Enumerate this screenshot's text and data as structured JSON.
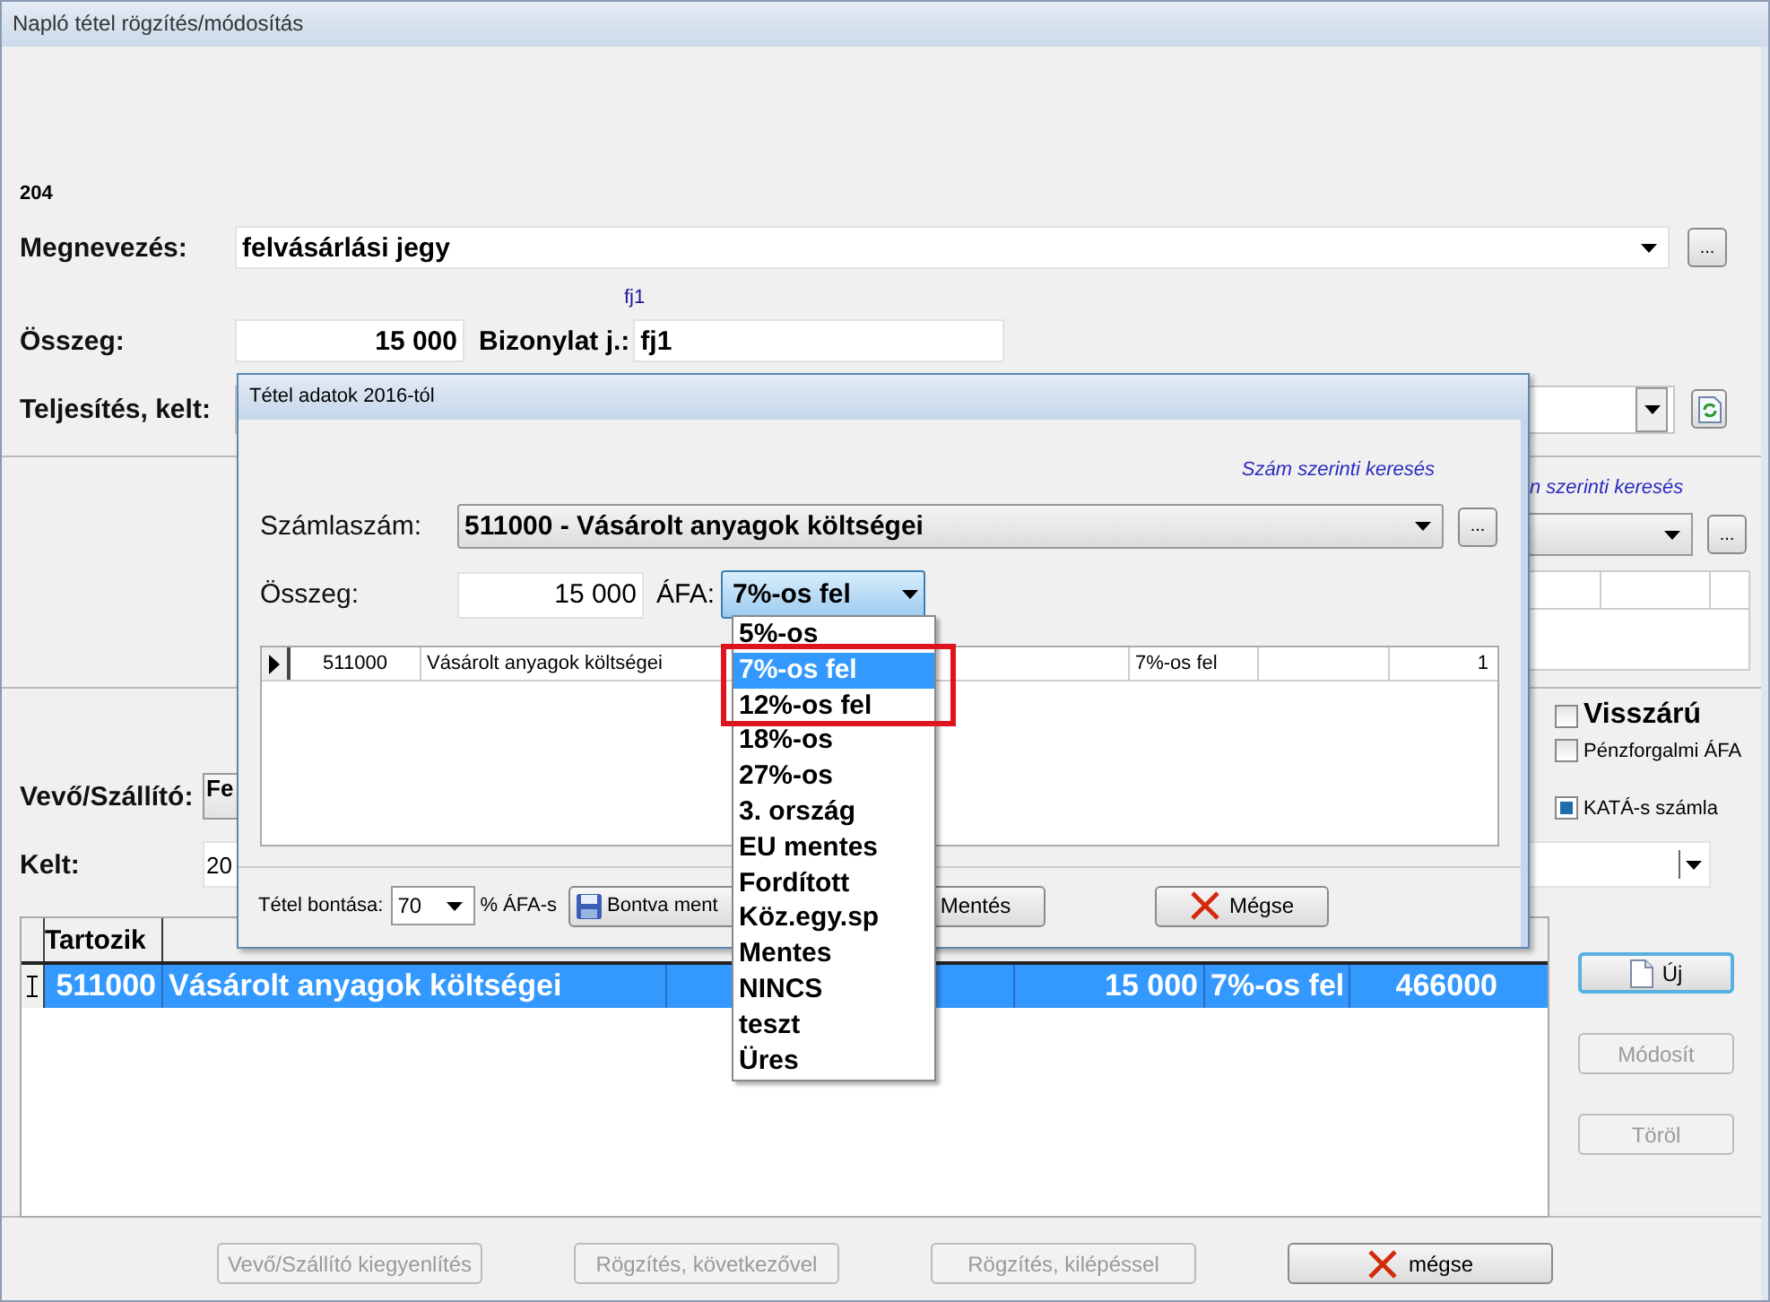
{
  "window": {
    "title": "Napló tétel rögzítés/módosítás"
  },
  "record_number": "204",
  "name_row": {
    "label": "Megnevezés:",
    "value": "felvásárlási jegy",
    "more_button": "..."
  },
  "document_hint": "fj1",
  "amount_row": {
    "label": "Összeg:",
    "value": "15 000",
    "document_label": "Bizonylat j.:",
    "document_value": "fj1"
  },
  "completion_row": {
    "label": "Teljesítés, kelt:"
  },
  "account_search": {
    "link": "n szerinti keresés",
    "more_button": "..."
  },
  "partner": {
    "label": "Vevő/Szállító:",
    "value": "Fe"
  },
  "date": {
    "label": "Kelt:",
    "value": "20"
  },
  "checkboxes": [
    {
      "label": "Visszárú",
      "checked": false,
      "kind": "large"
    },
    {
      "label": "Pénzforgalmi ÁFA",
      "checked": false,
      "kind": "small"
    },
    {
      "label": "KATÁ-s számla",
      "checked": true,
      "kind": "small"
    }
  ],
  "table": {
    "columns": [
      "Tartozik"
    ],
    "rows": [
      {
        "selected": true,
        "account": "511000",
        "name": "Vásárolt anyagok költségei",
        "amount": "15 000",
        "vat": "7%-os fel",
        "column_7": "466000"
      }
    ]
  },
  "side_buttons": [
    {
      "label": "Új",
      "disabled": false,
      "kind": "new"
    },
    {
      "label": "Módosít",
      "disabled": true,
      "kind": "plain"
    },
    {
      "label": "Töröl",
      "disabled": true,
      "kind": "plain"
    }
  ],
  "bottom_buttons": [
    {
      "label": "Vevő/Szállító kiegyenlítés",
      "disabled": true,
      "kind": "plain"
    },
    {
      "label": "Rögzítés, következővel",
      "disabled": true,
      "kind": "plain"
    },
    {
      "label": "Rögzítés, kilépéssel",
      "disabled": true,
      "kind": "plain"
    },
    {
      "label": "mégse",
      "disabled": false,
      "kind": "cancel"
    }
  ],
  "dialog": {
    "title": "Tétel adatok 2016-tól",
    "search_link": "Szám szerinti keresés",
    "account_label": "Számlaszám:",
    "account_value": "511000 - Vásárolt anyagok költségei",
    "more_button": "...",
    "amount_label": "Összeg:",
    "amount_value": "15 000",
    "vat_label": "ÁFA:",
    "vat_value": "7%-os fel",
    "grid_row": {
      "account": "511000",
      "name": "Vásárolt anyagok költségei",
      "vat": "7%-os fel",
      "column_6": "1"
    },
    "split_label": "Tétel bontása:",
    "split_value": "70",
    "split_unit": "% ÁFA-s",
    "buttons": [
      {
        "label": "Bontva ment",
        "kind": "save"
      },
      {
        "label": "Mentés",
        "kind": "plain"
      },
      {
        "label": "Mégse",
        "kind": "cancel"
      }
    ]
  },
  "vat_dropdown": {
    "options": [
      {
        "label": "5%-os",
        "selected": false
      },
      {
        "label": "7%-os fel",
        "selected": true
      },
      {
        "label": "12%-os fel",
        "selected": false
      },
      {
        "label": "18%-os",
        "selected": false
      },
      {
        "label": "27%-os",
        "selected": false
      },
      {
        "label": "3. ország",
        "selected": false
      },
      {
        "label": "EU mentes",
        "selected": false
      },
      {
        "label": "Fordított",
        "selected": false
      },
      {
        "label": "Köz.egy.sp",
        "selected": false
      },
      {
        "label": "Mentes",
        "selected": false
      },
      {
        "label": "NINCS",
        "selected": false
      },
      {
        "label": "teszt",
        "selected": false
      },
      {
        "label": "Üres",
        "selected": false
      }
    ]
  }
}
